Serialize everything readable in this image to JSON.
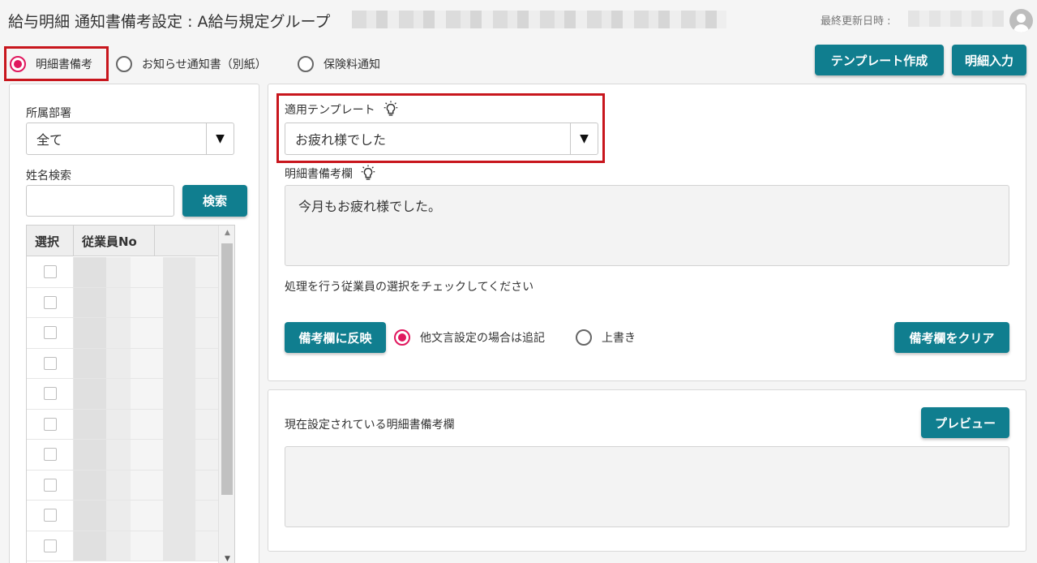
{
  "header": {
    "title": "給与明細 通知書備考設定 : A給与規定グループ",
    "last_updated_label": "最終更新日時 :"
  },
  "mode_radios": [
    {
      "label": "明細書備考",
      "checked": true
    },
    {
      "label": "お知らせ通知書（別紙）",
      "checked": false
    },
    {
      "label": "保険料通知",
      "checked": false
    }
  ],
  "top_buttons": {
    "template_create": "テンプレート作成",
    "detail_input": "明細入力"
  },
  "left_panel": {
    "dept_label": "所属部署",
    "dept_value": "全て",
    "name_search_label": "姓名検索",
    "name_search_value": "",
    "search_button": "検索",
    "table": {
      "headers": [
        "選択",
        "従業員No"
      ],
      "row_count": 10
    }
  },
  "template_panel": {
    "template_label": "適用テンプレート",
    "template_value": "お疲れ様でした",
    "remarks_label": "明細書備考欄",
    "remarks_value": "今月もお疲れ様でした。",
    "instruction": "処理を行う従業員の選択をチェックしてください",
    "apply_button": "備考欄に反映",
    "apply_options": [
      {
        "label": "他文言設定の場合は追記",
        "checked": true
      },
      {
        "label": "上書き",
        "checked": false
      }
    ],
    "clear_button": "備考欄をクリア"
  },
  "current_panel": {
    "label": "現在設定されている明細書備考欄",
    "preview_button": "プレビュー",
    "current_value": ""
  },
  "colors": {
    "accent": "#107e8f",
    "radio_checked": "#e0175e",
    "highlight_box": "#c8161d"
  },
  "icons": {
    "avatar": "user-avatar-icon",
    "bulb": "lightbulb-icon",
    "dropdown": "triangle-down-icon"
  }
}
